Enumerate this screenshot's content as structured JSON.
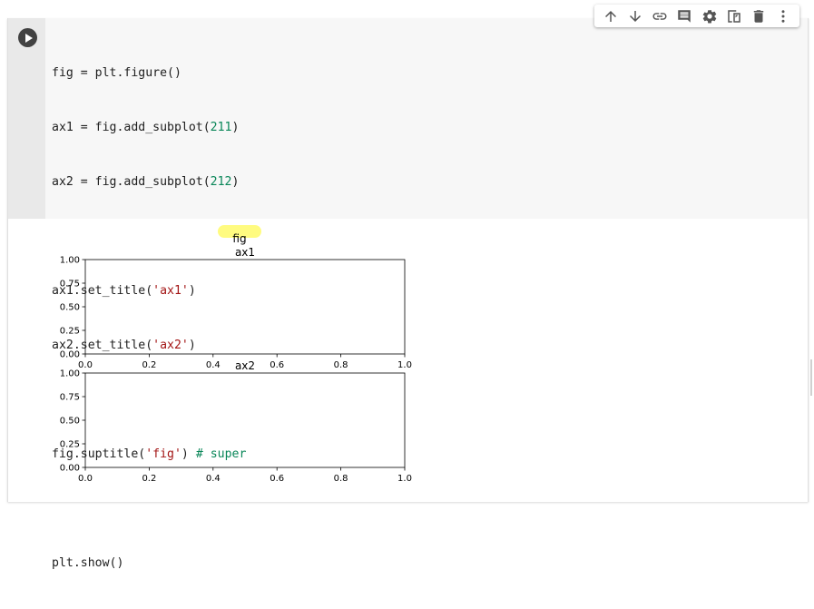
{
  "toolbar": {
    "buttons": [
      "move-up",
      "move-down",
      "link",
      "comment",
      "settings",
      "mirror-cell",
      "delete",
      "more"
    ]
  },
  "code": {
    "line1": {
      "a": "fig = plt.figure()"
    },
    "line2": {
      "a": "ax1 = fig.add_subplot(",
      "n": "211",
      "b": ")"
    },
    "line3": {
      "a": "ax2 = fig.add_subplot(",
      "n": "212",
      "b": ")"
    },
    "line4": {
      "a": "ax1.set_title(",
      "s": "'ax1'",
      "b": ")"
    },
    "line5": {
      "a": "ax2.set_title(",
      "s": "'ax2'",
      "b": ")"
    },
    "line6": {
      "a": "fig.suptitle(",
      "s": "'fig'",
      "b": ")",
      "c": " # super"
    },
    "line7": {
      "a": "plt.show()"
    }
  },
  "colors": {
    "highlight": "#fffb80",
    "number": "#098658",
    "string": "#a31515",
    "comment": "#098658"
  },
  "chart_data": {
    "type": "line",
    "suptitle": "fig",
    "axes": [
      {
        "title": "ax1",
        "xlim": [
          0,
          1
        ],
        "ylim": [
          0,
          1
        ],
        "xticks": [
          "0.0",
          "0.2",
          "0.4",
          "0.6",
          "0.8",
          "1.0"
        ],
        "yticks": [
          "0.00",
          "0.25",
          "0.50",
          "0.75",
          "1.00"
        ],
        "series": []
      },
      {
        "title": "ax2",
        "xlim": [
          0,
          1
        ],
        "ylim": [
          0,
          1
        ],
        "xticks": [
          "0.0",
          "0.2",
          "0.4",
          "0.6",
          "0.8",
          "1.0"
        ],
        "yticks": [
          "0.00",
          "0.25",
          "0.50",
          "0.75",
          "1.00"
        ],
        "series": []
      }
    ]
  }
}
